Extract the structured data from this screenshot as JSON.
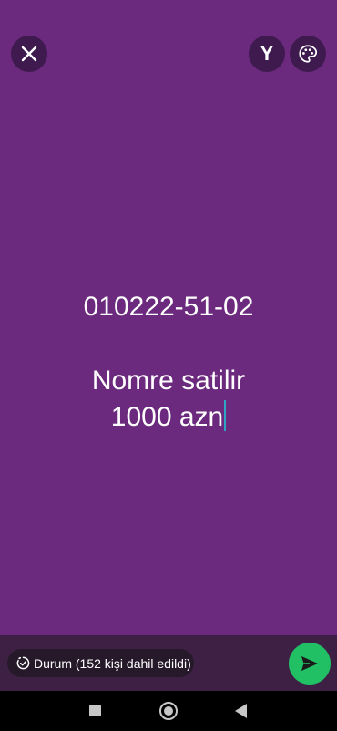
{
  "toolbar": {
    "close_icon": "close-icon",
    "font_label": "Y",
    "palette_icon": "palette-icon"
  },
  "status": {
    "line1": "010222-51-02",
    "line2": "Nomre satilir",
    "line3": "1000 azn"
  },
  "footer": {
    "audience_label": "Durum (152 kişi dahil edildi)",
    "audience_icon": "status-ring-icon",
    "send_icon": "send-icon"
  },
  "nav": {
    "recents_icon": "recents-icon",
    "home_icon": "home-icon",
    "back_icon": "back-icon"
  },
  "colors": {
    "background": "#6b2a7d",
    "button_bg": "#3e1a4f",
    "send_green": "#21c064",
    "cursor": "#2fa5c4"
  }
}
